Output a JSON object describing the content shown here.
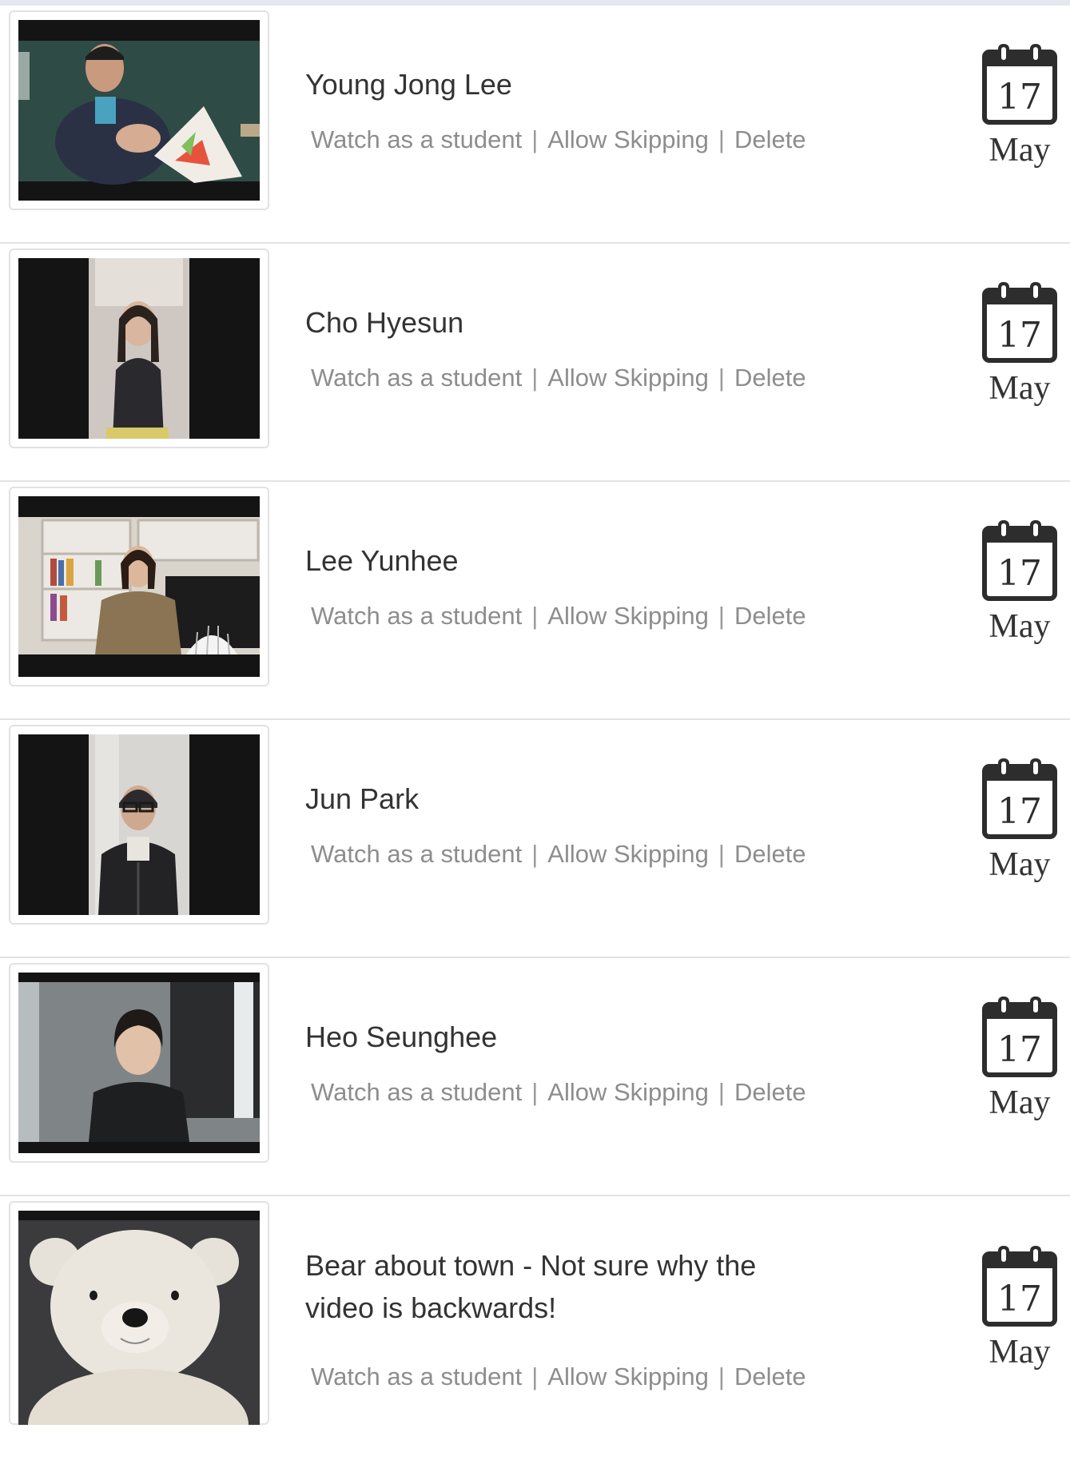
{
  "videos": [
    {
      "title": "Young Jong Lee",
      "actions": {
        "watch": "Watch as a student",
        "skip": "Allow Skipping",
        "delete": "Delete"
      },
      "date": {
        "day": "17",
        "month": "May"
      }
    },
    {
      "title": "Cho Hyesun",
      "actions": {
        "watch": "Watch as a student",
        "skip": "Allow Skipping",
        "delete": "Delete"
      },
      "date": {
        "day": "17",
        "month": "May"
      }
    },
    {
      "title": "Lee Yunhee",
      "actions": {
        "watch": "Watch as a student",
        "skip": "Allow Skipping",
        "delete": "Delete"
      },
      "date": {
        "day": "17",
        "month": "May"
      }
    },
    {
      "title": "Jun Park",
      "actions": {
        "watch": "Watch as a student",
        "skip": "Allow Skipping",
        "delete": "Delete"
      },
      "date": {
        "day": "17",
        "month": "May"
      }
    },
    {
      "title": "Heo Seunghee",
      "actions": {
        "watch": "Watch as a student",
        "skip": "Allow Skipping",
        "delete": "Delete"
      },
      "date": {
        "day": "17",
        "month": "May"
      }
    },
    {
      "title": "Bear about town - Not sure why the video is backwards!",
      "actions": {
        "watch": "Watch as a student",
        "skip": "Allow Skipping",
        "delete": "Delete"
      },
      "date": {
        "day": "17",
        "month": "May"
      }
    }
  ],
  "icons": {
    "calendar": "calendar-icon",
    "separator": "|"
  },
  "colors": {
    "link": "#8d8d8d",
    "title": "#333333",
    "divider": "#e3e3e3",
    "thumb_bg": "#141414"
  }
}
